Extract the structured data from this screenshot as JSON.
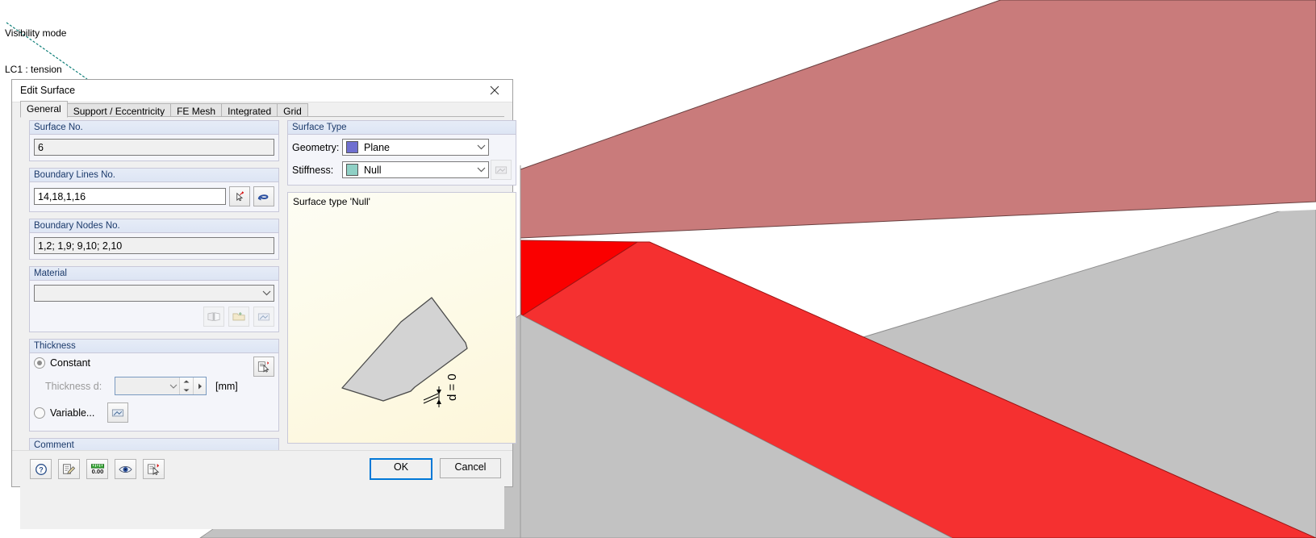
{
  "viewport": {
    "status_lines": [
      "Visibility mode",
      "LC1 : tension"
    ]
  },
  "dialog": {
    "title": "Edit Surface",
    "close_icon": "close-icon",
    "tabs": [
      {
        "label": "General",
        "active": true
      },
      {
        "label": "Support / Eccentricity",
        "active": false
      },
      {
        "label": "FE Mesh",
        "active": false
      },
      {
        "label": "Integrated",
        "active": false
      },
      {
        "label": "Grid",
        "active": false
      }
    ],
    "surface_no": {
      "legend": "Surface No.",
      "value": "6"
    },
    "boundary_lines": {
      "legend": "Boundary Lines No.",
      "value": "14,18,1,16",
      "pick_button": "pick-lines-icon",
      "chain_button": "select-chain-icon"
    },
    "boundary_nodes": {
      "legend": "Boundary Nodes No.",
      "value": "1,2; 1,9; 9,10; 2,10"
    },
    "material": {
      "legend": "Material",
      "value": "",
      "buttons": [
        "material-library-icon",
        "new-material-icon",
        "import-material-icon"
      ]
    },
    "thickness": {
      "legend": "Thickness",
      "constant_label": "Constant",
      "constant_selected": true,
      "thickness_label": "Thickness d:",
      "thickness_value": "",
      "unit": "[mm]",
      "variable_label": "Variable...",
      "variable_selected": false,
      "edit_button": "edit-thickness-icon",
      "variable_button": "variable-thickness-icon"
    },
    "comment": {
      "legend": "Comment",
      "value": "",
      "button": "comment-library-icon"
    },
    "surface_type": {
      "legend": "Surface Type",
      "geometry_label": "Geometry:",
      "geometry_value": "Plane",
      "geometry_color": "#6f6fd0",
      "stiffness_label": "Stiffness:",
      "stiffness_value": "Null",
      "stiffness_color": "#8fd0c5",
      "stiffness_button": "stiffness-settings-icon"
    },
    "preview": {
      "caption": "Surface type 'Null'",
      "dimension_label": "d = 0"
    },
    "footer": {
      "tools": [
        {
          "name": "help-icon",
          "label": "?"
        },
        {
          "name": "edit-note-icon",
          "label": ""
        },
        {
          "name": "units-icon",
          "label": "0.00"
        },
        {
          "name": "view-icon",
          "label": ""
        },
        {
          "name": "pick-visibility-icon",
          "label": ""
        }
      ],
      "ok_label": "OK",
      "cancel_label": "Cancel"
    }
  }
}
